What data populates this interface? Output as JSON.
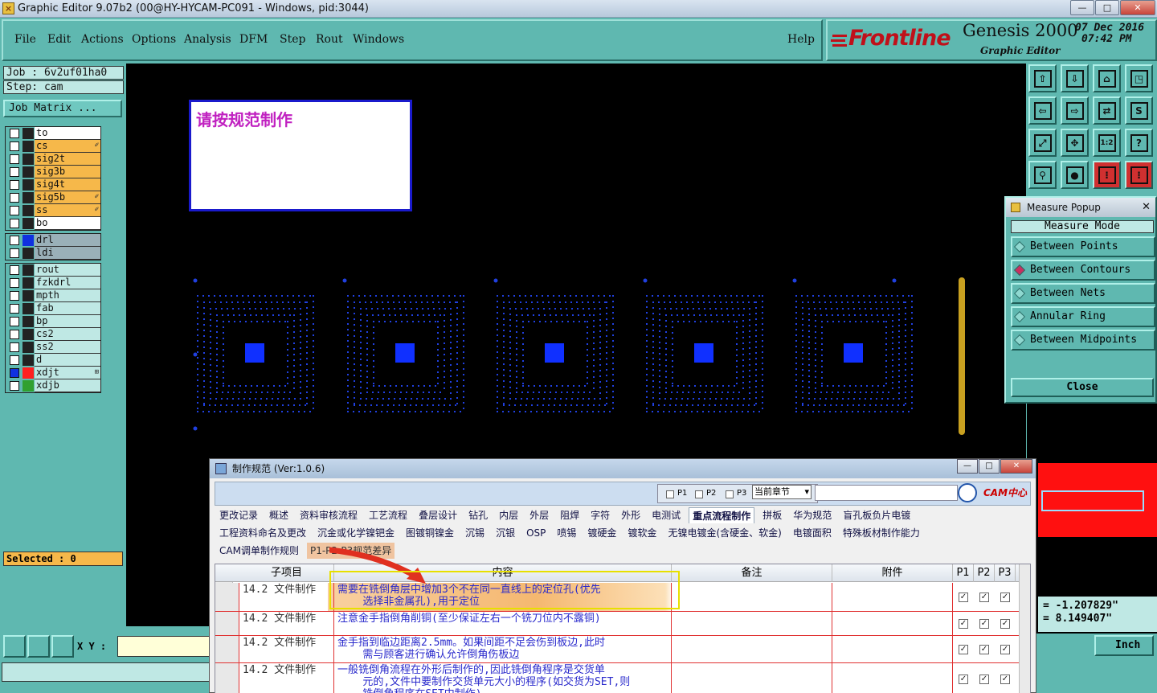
{
  "window": {
    "title": "Graphic Editor 9.07b2 (00@HY-HYCAM-PC091 - Windows, pid:3044)",
    "min": "—",
    "max": "□",
    "close": "✕",
    "icon_label": "×"
  },
  "menu": [
    "File",
    "Edit",
    "Actions",
    "Options",
    "Analysis",
    "DFM",
    "Step",
    "Rout",
    "Windows"
  ],
  "help": "Help",
  "brand": {
    "logo": "Frontline",
    "product": "Genesis 2000",
    "subtitle": "Graphic Editor",
    "date": "07 Dec 2016",
    "time": "07:42 PM"
  },
  "job": {
    "job": "Job : 6v2uf01ha0",
    "step": "Step: cam",
    "matrix": "Job Matrix ..."
  },
  "layers_group1": [
    {
      "name": "to",
      "color": "#ffffff",
      "mark": ""
    },
    {
      "name": "cs",
      "color": "#f6b84a",
      "mark": "✐"
    },
    {
      "name": "sig2t",
      "color": "#f6b84a",
      "mark": ""
    },
    {
      "name": "sig3b",
      "color": "#f6b84a",
      "mark": ""
    },
    {
      "name": "sig4t",
      "color": "#f6b84a",
      "mark": ""
    },
    {
      "name": "sig5b",
      "color": "#f6b84a",
      "mark": "✐"
    },
    {
      "name": "ss",
      "color": "#f6b84a",
      "mark": "✐"
    },
    {
      "name": "bo",
      "color": "#ffffff",
      "mark": ""
    }
  ],
  "layers_group2": [
    {
      "name": "drl",
      "color": "#9ab0b8",
      "swatch": "#1030e0",
      "mark": ""
    },
    {
      "name": "ldi",
      "color": "#9ab0b8",
      "swatch": "",
      "mark": ""
    }
  ],
  "layers_group3": [
    {
      "name": "rout",
      "color": "#bfe8e4",
      "swatch": "",
      "mark": ""
    },
    {
      "name": "fzkdrl",
      "color": "#bfe8e4",
      "swatch": "",
      "mark": ""
    },
    {
      "name": "mpth",
      "color": "#bfe8e4",
      "swatch": "",
      "mark": ""
    },
    {
      "name": "fab",
      "color": "#bfe8e4",
      "swatch": "",
      "mark": ""
    },
    {
      "name": "bp",
      "color": "#bfe8e4",
      "swatch": "",
      "mark": ""
    },
    {
      "name": "cs2",
      "color": "#bfe8e4",
      "swatch": "",
      "mark": ""
    },
    {
      "name": "ss2",
      "color": "#bfe8e4",
      "swatch": "",
      "mark": ""
    },
    {
      "name": "d",
      "color": "#bfe8e4",
      "swatch": "",
      "mark": ""
    },
    {
      "name": "xdjt",
      "color": "#bfe8e4",
      "swatch": "#ff2020",
      "mark": "⊞",
      "chk": "#1030e0"
    },
    {
      "name": "xdjb",
      "color": "#bfe8e4",
      "swatch": "#30a030",
      "mark": ""
    }
  ],
  "selected": "Selected : 0",
  "canvas_note": "请按规范制作",
  "measure": {
    "title": "Measure Popup",
    "close_x": "✕",
    "mode_header": "Measure Mode",
    "modes": [
      "Between Points",
      "Between Contours",
      "Between Nets",
      "Annular Ring",
      "Between Midpoints"
    ],
    "selected_mode": "Between Contours",
    "close": "Close"
  },
  "coords": {
    "x": "= -1.207829\"",
    "y": "= 8.149407\""
  },
  "units": "Inch",
  "xy_label": "X Y :",
  "dialog": {
    "title": "制作规范 (Ver:1.0.6)",
    "filters": [
      "P1",
      "P2",
      "P3"
    ],
    "scope": "当前章节",
    "search_placeholder": "",
    "logo": "CAM中心",
    "tabs_row1": [
      "更改记录",
      "概述",
      "资料审核流程",
      "工艺流程",
      "叠层设计",
      "钻孔",
      "内层",
      "外层",
      "阻焊",
      "字符",
      "外形",
      "电测试",
      "重点流程制作",
      "拼板",
      "华为规范",
      "盲孔板负片电镀"
    ],
    "tabs_row2": [
      "工程资料命名及更改",
      "沉金或化学镍钯金",
      "图镀铜镍金",
      "沉锡",
      "沉银",
      "OSP",
      "喷锡",
      "镀硬金",
      "镀软金",
      "无镍电镀金(含硬金、软金)",
      "电镀面积",
      "特殊板材制作能力"
    ],
    "tabs_row3": [
      "CAM调单制作规则",
      "P1-P2-P3规范差异"
    ],
    "active_tab": "重点流程制作",
    "columns": [
      "子项目",
      "内容",
      "备注",
      "附件",
      "P1",
      "P2",
      "P3"
    ],
    "rows": [
      {
        "sub": "14.2 文件制作",
        "content": "需要在铣倒角层中增加3个不在同一直线上的定位孔(优先\n    选择非金属孔),用于定位",
        "p": [
          "✓",
          "✓",
          "✓"
        ]
      },
      {
        "sub": "14.2 文件制作",
        "content": "注意金手指倒角削铜(至少保证左右一个铣刀位内不露铜)",
        "p": [
          "✓",
          "✓",
          "✓"
        ]
      },
      {
        "sub": "14.2 文件制作",
        "content": "金手指到临边距离2.5mm。如果间距不足会伤到板边,此时\n    需与顾客进行确认允许倒角伤板边",
        "p": [
          "✓",
          "✓",
          "✓"
        ]
      },
      {
        "sub": "14.2 文件制作",
        "content": "一般铣倒角流程在外形后制作的,因此铣倒角程序是交货单\n    元的,文件中要制作交货单元大小的程序(如交货为SET,则\n    铣倒角程序在SET中制作)",
        "p": [
          "✓",
          "✓",
          "✓"
        ]
      }
    ]
  }
}
